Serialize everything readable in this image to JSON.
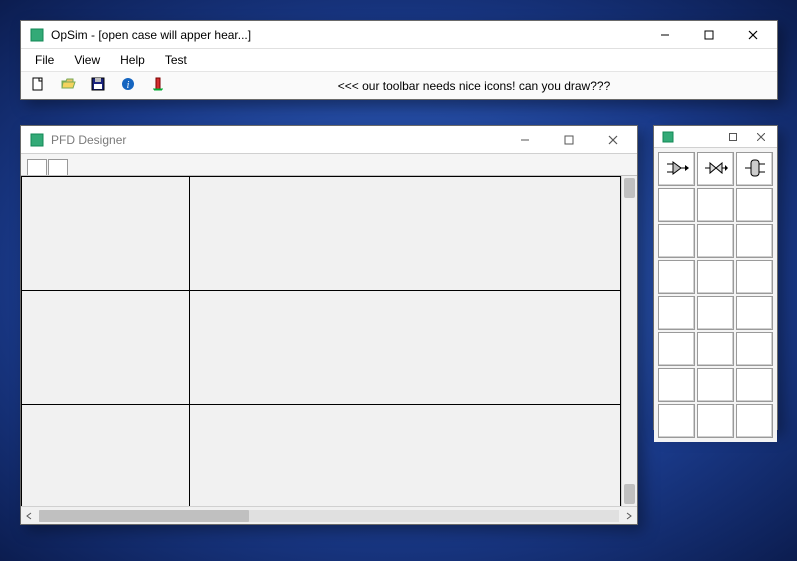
{
  "main": {
    "title": "OpSim - [open case will apper hear...]",
    "menus": [
      "File",
      "View",
      "Help",
      "Test"
    ],
    "toolbar_message": "<<< our toolbar needs nice icons! can you draw???"
  },
  "pfd": {
    "title": "PFD Designer"
  },
  "palette": {
    "items": [
      "mixer",
      "valve",
      "column"
    ]
  }
}
